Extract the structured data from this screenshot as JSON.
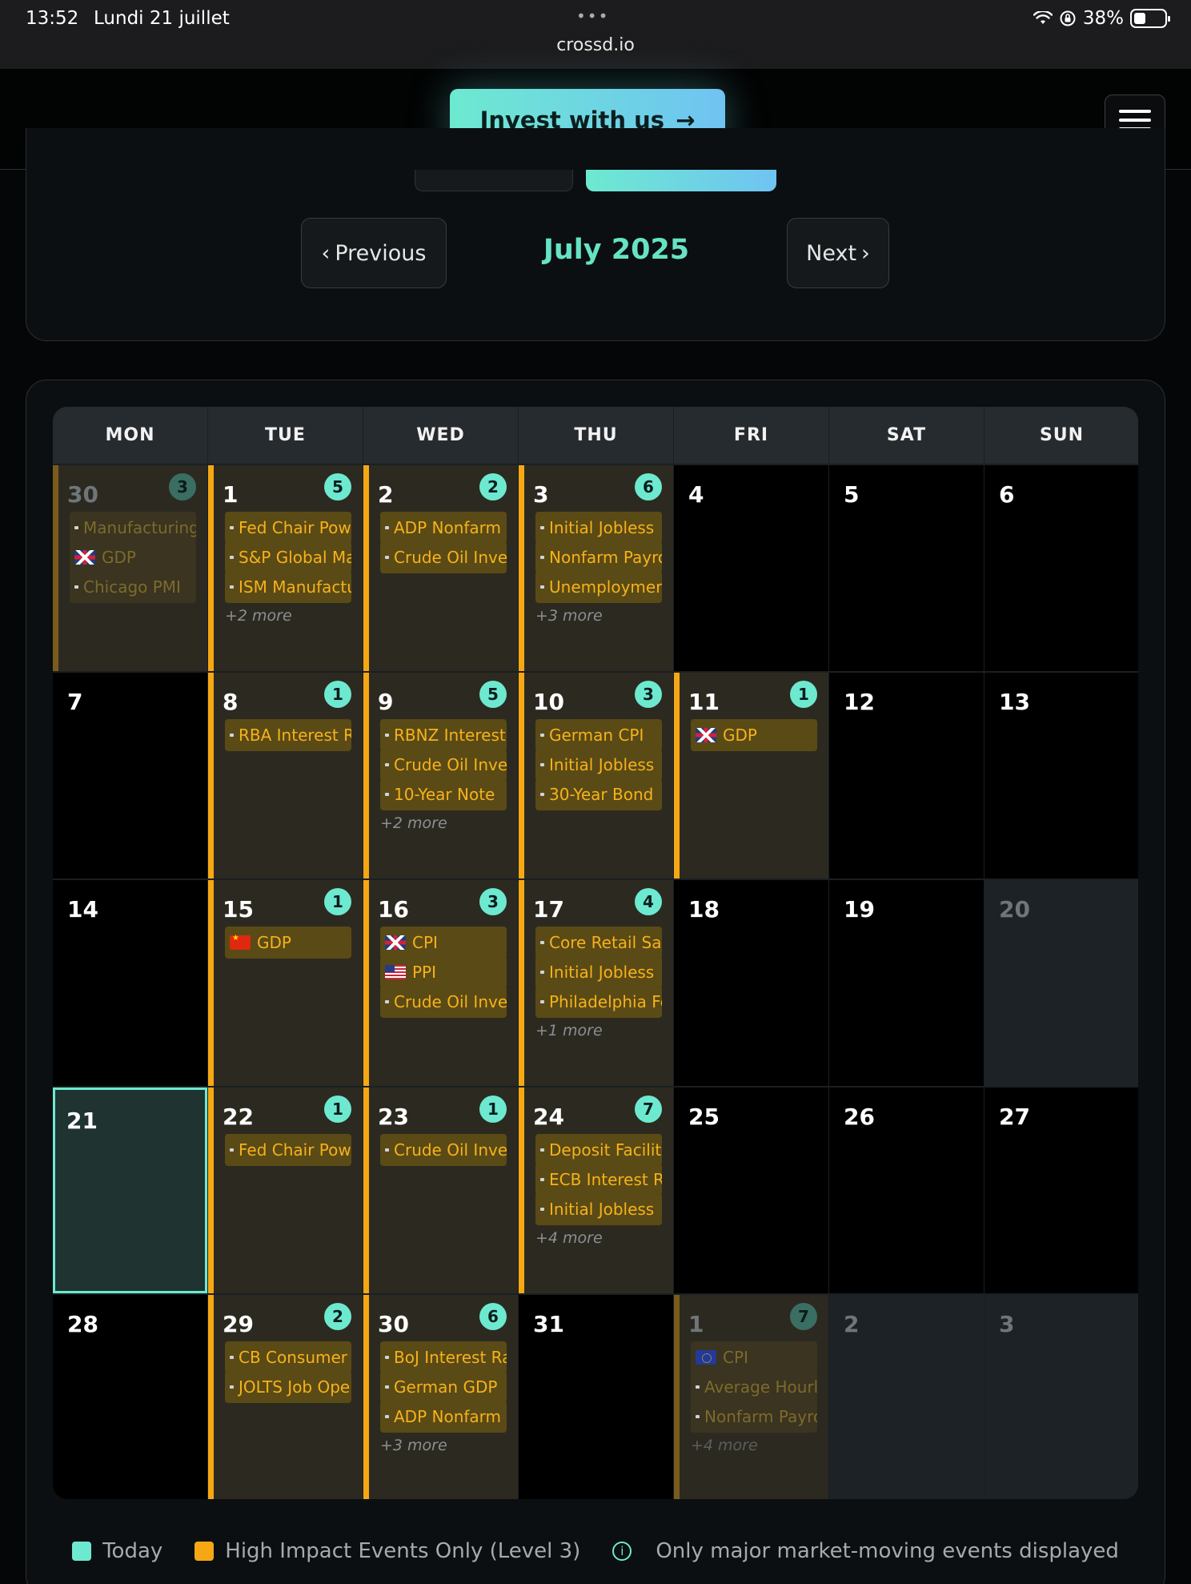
{
  "status_bar": {
    "time": "13:52",
    "date": "Lundi 21 juillet",
    "url": "crossd.io",
    "battery": "38%",
    "dots": "•••"
  },
  "header": {
    "invest_label": "Invest with us",
    "invest_arrow": "→"
  },
  "nav": {
    "prev_label": "Previous",
    "next_label": "Next",
    "prev_icon": "‹",
    "next_icon": "›",
    "month_title": "July 2025"
  },
  "colors": {
    "accent_teal": "#6de9d0",
    "high_impact_orange": "#f5a814",
    "event_text": "#f6b21a"
  },
  "weekdays": [
    "MON",
    "TUE",
    "WED",
    "THU",
    "FRI",
    "SAT",
    "SUN"
  ],
  "weeks": [
    [
      {
        "day": "30",
        "badge": "3",
        "style": "dim",
        "events": [
          {
            "flag": "tiny",
            "label": "Manufacturing"
          },
          {
            "flag": "uk",
            "label": "GDP"
          },
          {
            "flag": "tiny",
            "label": "Chicago PMI"
          }
        ],
        "more": ""
      },
      {
        "day": "1",
        "badge": "5",
        "style": "events",
        "events": [
          {
            "flag": "tiny",
            "label": "Fed Chair Powell"
          },
          {
            "flag": "tiny",
            "label": "S&P Global Manufacturing"
          },
          {
            "flag": "tiny",
            "label": "ISM Manufacturing"
          }
        ],
        "more": "+2 more"
      },
      {
        "day": "2",
        "badge": "2",
        "style": "events",
        "events": [
          {
            "flag": "tiny",
            "label": "ADP Nonfarm"
          },
          {
            "flag": "tiny",
            "label": "Crude Oil Inventories"
          }
        ],
        "more": ""
      },
      {
        "day": "3",
        "badge": "6",
        "style": "events",
        "events": [
          {
            "flag": "tiny",
            "label": "Initial Jobless"
          },
          {
            "flag": "tiny",
            "label": "Nonfarm Payrolls"
          },
          {
            "flag": "tiny",
            "label": "Unemployment"
          }
        ],
        "more": "+3 more"
      },
      {
        "day": "4",
        "badge": "",
        "style": "plain",
        "events": [],
        "more": ""
      },
      {
        "day": "5",
        "badge": "",
        "style": "plain",
        "events": [],
        "more": ""
      },
      {
        "day": "6",
        "badge": "",
        "style": "plain",
        "events": [],
        "more": ""
      }
    ],
    [
      {
        "day": "7",
        "badge": "",
        "style": "plain",
        "events": [],
        "more": ""
      },
      {
        "day": "8",
        "badge": "1",
        "style": "events",
        "events": [
          {
            "flag": "tiny",
            "label": "RBA Interest Rate"
          }
        ],
        "more": ""
      },
      {
        "day": "9",
        "badge": "5",
        "style": "events",
        "events": [
          {
            "flag": "tiny",
            "label": "RBNZ Interest"
          },
          {
            "flag": "tiny",
            "label": "Crude Oil Inventories"
          },
          {
            "flag": "tiny",
            "label": "10-Year Note"
          }
        ],
        "more": "+2 more"
      },
      {
        "day": "10",
        "badge": "3",
        "style": "events",
        "events": [
          {
            "flag": "tiny",
            "label": "German CPI"
          },
          {
            "flag": "tiny",
            "label": "Initial Jobless"
          },
          {
            "flag": "tiny",
            "label": "30-Year Bond"
          }
        ],
        "more": ""
      },
      {
        "day": "11",
        "badge": "1",
        "style": "events",
        "events": [
          {
            "flag": "uk",
            "label": "GDP"
          }
        ],
        "more": ""
      },
      {
        "day": "12",
        "badge": "",
        "style": "plain",
        "events": [],
        "more": ""
      },
      {
        "day": "13",
        "badge": "",
        "style": "plain",
        "events": [],
        "more": ""
      }
    ],
    [
      {
        "day": "14",
        "badge": "",
        "style": "plain",
        "events": [],
        "more": ""
      },
      {
        "day": "15",
        "badge": "1",
        "style": "events",
        "events": [
          {
            "flag": "cn",
            "label": "GDP"
          }
        ],
        "more": ""
      },
      {
        "day": "16",
        "badge": "3",
        "style": "events",
        "events": [
          {
            "flag": "uk",
            "label": "CPI"
          },
          {
            "flag": "us",
            "label": "PPI"
          },
          {
            "flag": "tiny",
            "label": "Crude Oil Inventories"
          }
        ],
        "more": ""
      },
      {
        "day": "17",
        "badge": "4",
        "style": "events",
        "events": [
          {
            "flag": "tiny",
            "label": "Core Retail Sales"
          },
          {
            "flag": "tiny",
            "label": "Initial Jobless"
          },
          {
            "flag": "tiny",
            "label": "Philadelphia Fed"
          }
        ],
        "more": "+1 more"
      },
      {
        "day": "18",
        "badge": "",
        "style": "plain",
        "events": [],
        "more": ""
      },
      {
        "day": "19",
        "badge": "",
        "style": "plain",
        "events": [],
        "more": ""
      },
      {
        "day": "20",
        "badge": "",
        "style": "grey",
        "events": [],
        "more": ""
      }
    ],
    [
      {
        "day": "21",
        "badge": "",
        "style": "today",
        "events": [],
        "more": ""
      },
      {
        "day": "22",
        "badge": "1",
        "style": "events",
        "events": [
          {
            "flag": "tiny",
            "label": "Fed Chair Powell"
          }
        ],
        "more": ""
      },
      {
        "day": "23",
        "badge": "1",
        "style": "events",
        "events": [
          {
            "flag": "tiny",
            "label": "Crude Oil Inventories"
          }
        ],
        "more": ""
      },
      {
        "day": "24",
        "badge": "7",
        "style": "events",
        "events": [
          {
            "flag": "tiny",
            "label": "Deposit Facility"
          },
          {
            "flag": "tiny",
            "label": "ECB Interest Rate"
          },
          {
            "flag": "tiny",
            "label": "Initial Jobless"
          }
        ],
        "more": "+4 more"
      },
      {
        "day": "25",
        "badge": "",
        "style": "plain",
        "events": [],
        "more": ""
      },
      {
        "day": "26",
        "badge": "",
        "style": "plain",
        "events": [],
        "more": ""
      },
      {
        "day": "27",
        "badge": "",
        "style": "plain",
        "events": [],
        "more": ""
      }
    ],
    [
      {
        "day": "28",
        "badge": "",
        "style": "plain",
        "events": [],
        "more": ""
      },
      {
        "day": "29",
        "badge": "2",
        "style": "events",
        "events": [
          {
            "flag": "tiny",
            "label": "CB Consumer"
          },
          {
            "flag": "tiny",
            "label": "JOLTS Job Openings"
          }
        ],
        "more": ""
      },
      {
        "day": "30",
        "badge": "6",
        "style": "events",
        "events": [
          {
            "flag": "tiny",
            "label": "BoJ Interest Rate"
          },
          {
            "flag": "tiny",
            "label": "German GDP"
          },
          {
            "flag": "tiny",
            "label": "ADP Nonfarm"
          }
        ],
        "more": "+3 more"
      },
      {
        "day": "31",
        "badge": "",
        "style": "plain",
        "events": [],
        "more": ""
      },
      {
        "day": "1",
        "badge": "7",
        "style": "dim",
        "events": [
          {
            "flag": "eu",
            "label": "CPI"
          },
          {
            "flag": "tiny",
            "label": "Average Hourly"
          },
          {
            "flag": "tiny",
            "label": "Nonfarm Payrolls"
          }
        ],
        "more": "+4 more"
      },
      {
        "day": "2",
        "badge": "",
        "style": "other",
        "events": [],
        "more": ""
      },
      {
        "day": "3",
        "badge": "",
        "style": "other",
        "events": [],
        "more": ""
      }
    ]
  ],
  "legend": {
    "today": "Today",
    "high_impact": "High Impact Events Only (Level 3)",
    "info": "Only major market-moving events displayed",
    "info_icon": "i"
  }
}
